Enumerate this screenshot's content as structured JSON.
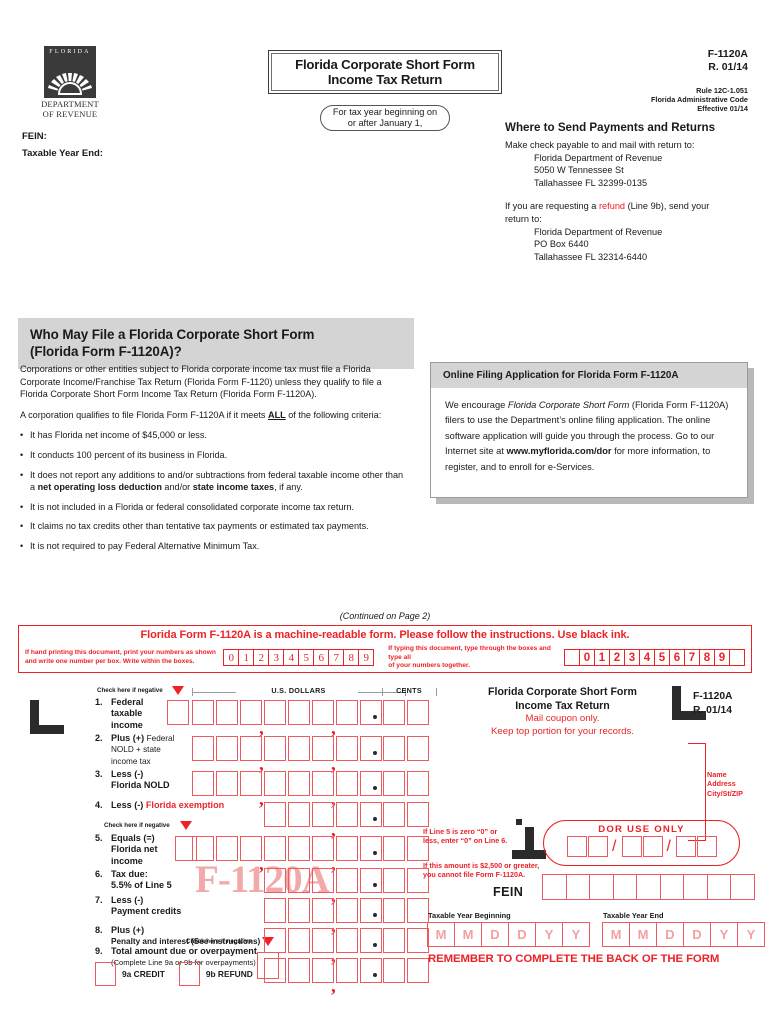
{
  "header": {
    "logo": {
      "top_text": "FLORIDA",
      "bottom_line1": "DEPARTMENT",
      "bottom_line2": "OF REVENUE",
      "icon": "sunburst-icon"
    },
    "fein_label": "FEIN:",
    "taxable_year_end_label": "Taxable Year End:",
    "title_line1": "Florida Corporate Short Form",
    "title_line2": "Income Tax Return",
    "tax_year_line1": "For tax year beginning on",
    "tax_year_line2": "or after January 1,",
    "form_number": "F-1120A",
    "revision": "R. 01/14",
    "rule_line1": "Rule 12C-1.051",
    "rule_line2": "Florida Administrative Code",
    "rule_line3": "Effective 01/14"
  },
  "send": {
    "heading": "Where to Send Payments and Returns",
    "intro": "Make check payable to and mail with return to:",
    "addr1_line1": "Florida Department of Revenue",
    "addr1_line2": "5050 W Tennessee St",
    "addr1_line3": "Tallahassee FL 32399-0135",
    "refund_pre": "If you are requesting a ",
    "refund_word": "refund",
    "refund_post": " (Line 9b), send your",
    "refund_post2": "return to:",
    "addr2_line1": "Florida Department of Revenue",
    "addr2_line2": "PO Box 6440",
    "addr2_line3": "Tallahassee FL 32314-6440"
  },
  "who_may_file": {
    "heading_line1": "Who May File a Florida Corporate Short Form",
    "heading_line2": "(Florida Form F-1120A)?",
    "para1": "Corporations or other entities subject to Florida corporate income tax must file a Florida Corporate Income/Franchise Tax Return (Florida Form F-1120) unless they qualify to file a Florida Corporate Short Form Income Tax Return (Florida Form F-1120A).",
    "para2_pre": "A corporation qualifies to file Florida Form F-1120A if it meets ",
    "para2_bold": "ALL",
    "para2_post": " of the following criteria:",
    "bullets": [
      "It has Florida net income of $45,000 or less.",
      "It conducts 100 percent of its business in Florida.",
      "It does not report any additions to and/or subtractions from federal taxable income other than a net operating loss deduction and/or state income taxes, if any.",
      "It is not included in a Florida or federal consolidated corporate income tax return.",
      "It claims no tax credits other than tentative tax payments or estimated tax payments.",
      "It is not required to pay Federal Alternative Minimum Tax."
    ],
    "bullet3_parts": {
      "a": "It does not report any additions to and/or subtractions from federal taxable income other than a ",
      "b": "net operating loss deduction",
      "c": " and/or ",
      "d": "state income taxes",
      "e": ", if any."
    }
  },
  "online_filing": {
    "heading": "Online Filing Application for Florida Form F-1120A",
    "body_a": "We encourage ",
    "body_italic": "Florida Corporate Short Form",
    "body_b": " (Florida Form F-1120A) filers to use the Department’s online filing application. The online software application will guide you through the process. Go to our Internet site at ",
    "body_bold": "www.myflorida.com/dor",
    "body_c": " for more information, to register, and to enroll for e-Services."
  },
  "continued": "(Continued on Page 2)",
  "machine_banner": {
    "title": "Florida Form F-1120A is a machine-readable form. Please follow the instructions. Use black ink.",
    "note_left_line1": "If hand printing this document, print your numbers as shown",
    "note_left_line2": "and write one number per box.  Write within the boxes.",
    "note_right_line1": "If typing this document, type through the boxes and type all",
    "note_right_line2": "of your numbers together.",
    "hand_digits": [
      "0",
      "1",
      "2",
      "3",
      "4",
      "5",
      "6",
      "7",
      "8",
      "9"
    ],
    "typed_digits": [
      "",
      "0",
      "1",
      "2",
      "3",
      "4",
      "5",
      "6",
      "7",
      "8",
      "9",
      ""
    ]
  },
  "coupon": {
    "column_header_dollars": "U.S. DOLLARS",
    "column_header_cents": "CENTS",
    "check_negative_label": "Check here if negative",
    "lines": [
      {
        "num": "1.",
        "bold": "Federal",
        "rest": "taxable\nincome",
        "negative_check": true
      },
      {
        "num": "2.",
        "bold": "Plus (+)",
        "rest": " Federal\nNOLD + state\nincome tax",
        "negative_check": false
      },
      {
        "num": "3.",
        "bold": "Less (-)",
        "rest": "Florida NOLD",
        "negative_check": false
      },
      {
        "num": "4.",
        "bold": "Less (-)",
        "rest": "Florida exemption",
        "negative_check": false
      },
      {
        "num": "5.",
        "bold": "Equals (=)",
        "rest": "Florida net\nincome",
        "negative_check": true
      },
      {
        "num": "6.",
        "bold": "Tax due:",
        "rest": "5.5% of Line 5",
        "negative_check": false
      },
      {
        "num": "7.",
        "bold": "Less (-)",
        "rest": "Payment credits",
        "negative_check": false
      },
      {
        "num": "8.",
        "bold": "Plus (+)",
        "rest": "Penalty and interest (See instructions)",
        "negative_check": false
      },
      {
        "num": "9.",
        "bold": "Total amount due or overpayment",
        "rest": "(Complete Line 9a or 9b for overpayments)",
        "negative_check": true
      }
    ],
    "line4_label_black": "Less (-)",
    "line4_label_red": "Florida exemption",
    "line9a_label": "9a  CREDIT",
    "line9b_label": "9b  REFUND",
    "watermark": "F-1120A",
    "right_title_line1": "Florida Corporate Short Form",
    "right_title_line2": "Income Tax Return",
    "right_red_line1": "Mail coupon only.",
    "right_red_line2": "Keep top portion for your records.",
    "right_form_number": "F-1120A",
    "right_revision": "R. 01/14",
    "address_label_line1": "Name",
    "address_label_line2": "Address",
    "address_label_line3": "City/St/ZIP",
    "note_a_line1": "If Line 5 is zero “0” or",
    "note_a_line2": "less, enter “0” on Line 6.",
    "note_b_line1": "If this amount is $2,500 or greater,",
    "note_b_line2": "you cannot file Form F-1120A.",
    "dor_use_only": "DOR  USE  ONLY",
    "fein_label": "FEIN",
    "taxable_year_beginning": "Taxable Year Beginning",
    "taxable_year_end": "Taxable Year End",
    "date_mask": [
      "M",
      "M",
      "D",
      "D",
      "Y",
      "Y"
    ],
    "remember": "REMEMBER TO COMPLETE THE BACK OF THE FORM"
  },
  "colors": {
    "red": "#ec2227",
    "light_red": "#ee5a5f",
    "watermark_pink": "#f2a9aa",
    "gray_band": "#d4d4d4"
  }
}
